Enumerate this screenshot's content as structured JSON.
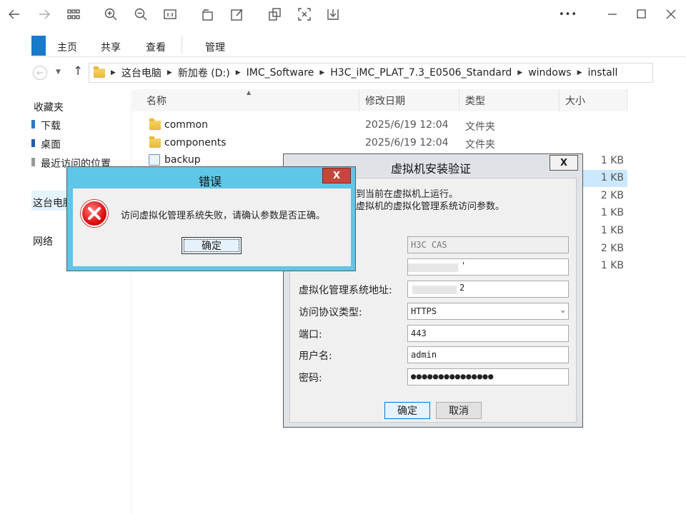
{
  "viewer": {
    "more_label": "•••"
  },
  "ribbon": {
    "tabs": [
      "主页",
      "共享",
      "查看",
      "管理"
    ]
  },
  "address": {
    "crumbs": [
      "这台电脑",
      "新加卷 (D:)",
      "IMC_Software",
      "H3C_iMC_PLAT_7.3_E0506_Standard",
      "windows",
      "install"
    ]
  },
  "nav": {
    "favorites": "收藏夹",
    "downloads": "下载",
    "desktop": "桌面",
    "recent": "最近访问的位置",
    "this_pc": "这台电脑",
    "network": "网络"
  },
  "list": {
    "headers": {
      "name": "名称",
      "modified": "修改日期",
      "type": "类型",
      "size": "大小"
    },
    "rows": [
      {
        "name": "common",
        "modified": "2025/6/19 12:04",
        "type": "文件夹"
      },
      {
        "name": "components",
        "modified": "2025/6/19 12:04",
        "type": "文件夹"
      },
      {
        "name": "backup"
      }
    ],
    "sizes": [
      "1 KB",
      "1 KB",
      "2 KB",
      "1 KB",
      "1 KB",
      "2 KB",
      "1 KB"
    ]
  },
  "vm_dialog": {
    "title": "虚拟机安装验证",
    "close": "X",
    "intro_line1": "到当前在虚拟机上运行。",
    "intro_line2": "虚拟机的虚拟化管理系统访问参数。",
    "field_type_value": "H3C CAS",
    "field_name_value": "'",
    "label_address": "虚拟化管理系统地址:",
    "field_address_value": "2",
    "label_protocol": "访问协议类型:",
    "protocol_value": "HTTPS",
    "label_port": "端口:",
    "port_value": "443",
    "label_user": "用户名:",
    "user_value": "admin",
    "label_password": "密码:",
    "password_value": "●●●●●●●●●●●●●●●",
    "ok": "确定",
    "cancel": "取消"
  },
  "error_dialog": {
    "title": "错误",
    "close": "X",
    "message": "访问虚拟化管理系统失败，请确认参数是否正确。",
    "ok": "确定"
  }
}
